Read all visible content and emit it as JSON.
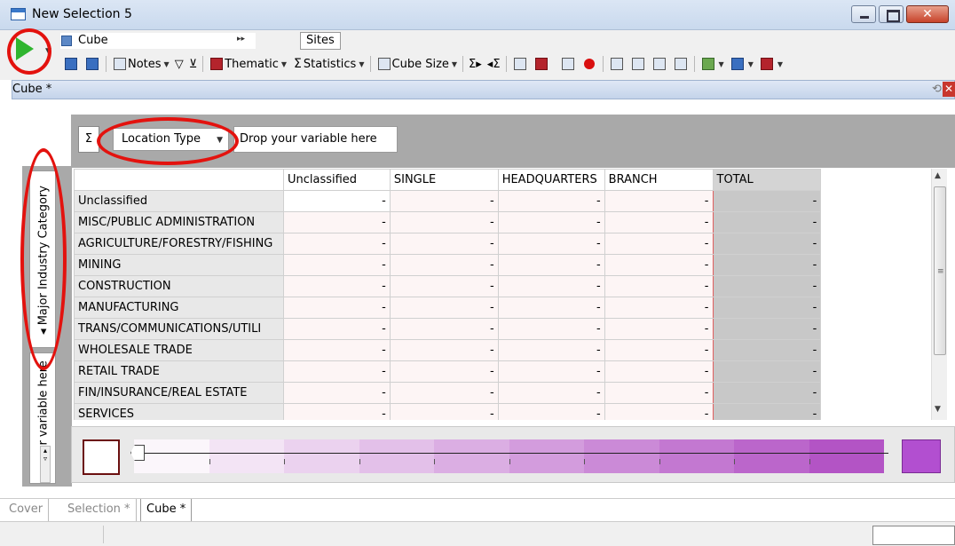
{
  "window": {
    "title": "New Selection 5",
    "close_glyph": "✕"
  },
  "toolbar": {
    "cube_combo": "Cube",
    "sites_label": "Sites",
    "notes": "Notes",
    "thematic": "Thematic",
    "statistics": "Statistics",
    "cube_size": "Cube Size",
    "sigma": "Σ"
  },
  "panel": {
    "title": "Cube *",
    "close_glyph": "✕"
  },
  "drop_zone": {
    "sum_label": "Σ",
    "column_variable": "Location Type",
    "column_drop_placeholder": "Drop your variable here",
    "row_variable": "◂ Major Industry Category",
    "row_drop_placeholder": "p your variable here"
  },
  "grid": {
    "columns": [
      "Unclassified",
      "SINGLE",
      "HEADQUARTERS",
      "BRANCH",
      "TOTAL"
    ],
    "rows": [
      {
        "label": "Unclassified",
        "values": [
          "-",
          "-",
          "-",
          "-",
          "-"
        ]
      },
      {
        "label": "MISC/PUBLIC ADMINISTRATION",
        "values": [
          "-",
          "-",
          "-",
          "-",
          "-"
        ]
      },
      {
        "label": "AGRICULTURE/FORESTRY/FISHING",
        "values": [
          "-",
          "-",
          "-",
          "-",
          "-"
        ]
      },
      {
        "label": "MINING",
        "values": [
          "-",
          "-",
          "-",
          "-",
          "-"
        ]
      },
      {
        "label": "CONSTRUCTION",
        "values": [
          "-",
          "-",
          "-",
          "-",
          "-"
        ]
      },
      {
        "label": "MANUFACTURING",
        "values": [
          "-",
          "-",
          "-",
          "-",
          "-"
        ]
      },
      {
        "label": "TRANS/COMMUNICATIONS/UTILI",
        "values": [
          "-",
          "-",
          "-",
          "-",
          "-"
        ]
      },
      {
        "label": "WHOLESALE TRADE",
        "values": [
          "-",
          "-",
          "-",
          "-",
          "-"
        ]
      },
      {
        "label": "RETAIL TRADE",
        "values": [
          "-",
          "-",
          "-",
          "-",
          "-"
        ]
      },
      {
        "label": "FIN/INSURANCE/REAL ESTATE",
        "values": [
          "-",
          "-",
          "-",
          "-",
          "-"
        ]
      },
      {
        "label": "SERVICES",
        "values": [
          "-",
          "-",
          "-",
          "-",
          "-"
        ]
      }
    ]
  },
  "legend": {
    "low_color": "#ffffff",
    "high_color": "#b24fd0",
    "gradient": [
      "#fbf6fb",
      "#f3e4f5",
      "#ebd2ef",
      "#e3c0e9",
      "#dbaee3",
      "#d39cdd",
      "#cb8ad7",
      "#c378d1",
      "#bb66cb",
      "#b354c5"
    ]
  },
  "tabs": [
    {
      "label": "Cover",
      "active": false
    },
    {
      "label": "Selection *",
      "active": false
    },
    {
      "label": "Cube *",
      "active": true
    }
  ],
  "colors": {
    "highlight": "#e3120e",
    "play": "#2fb52f"
  }
}
